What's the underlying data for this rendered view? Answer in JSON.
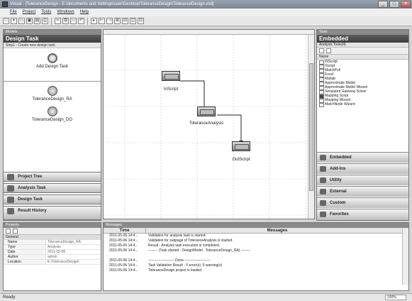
{
  "window": {
    "title": "Visual - [ToleranceDesign - E:\\documents and Settings\\user\\Desktop\\ToleranceDesign\\ToleranceDesign.vsd]",
    "controls": [
      "_",
      "□",
      "×"
    ]
  },
  "menu": {
    "items": [
      "File",
      "Project",
      "Tools",
      "Windows",
      "Help"
    ]
  },
  "toolbar": {
    "glyphs": [
      "□",
      "▾",
      "▭",
      "▣",
      "▤",
      "⎙",
      "✂",
      "⧉",
      "▭",
      "↶",
      "▸",
      "⊢",
      "⊣",
      "⊞",
      "⊟",
      "◫",
      "⊡"
    ]
  },
  "left_panel": {
    "section": "Models",
    "title": "Design Task",
    "hint": "Step1 : Create new design task.",
    "add_task_label": "Add Design Task",
    "tasks": [
      "ToleranceDesign_RA",
      "ToleranceDesign_DO"
    ],
    "nav": [
      "Project Tree",
      "Analysis Task",
      "Design Task",
      "Result History"
    ]
  },
  "properties": {
    "section": "Property",
    "category": "General",
    "rows": [
      {
        "key": "Name",
        "value": "ToleranceDesign_RA"
      },
      {
        "key": "Type",
        "value": "Analysis"
      },
      {
        "key": "Date",
        "value": "2011-05-06"
      },
      {
        "key": "Author",
        "value": "admin"
      },
      {
        "key": "Location",
        "value": "E:\\ToleranceDesign\\"
      }
    ]
  },
  "canvas": {
    "nodes": [
      "InScript",
      "ToleranceAnalysis",
      "OutScript"
    ]
  },
  "right_panel": {
    "section": "Tools",
    "title": "Embedded",
    "subtitle": "Analysis Tools(4)",
    "column": "Name",
    "items": [
      "INScript",
      "IScript",
      "MatchPoll",
      "Excel",
      "Matlab",
      "Approximate Model",
      "Approximate Model Wizard",
      "Simulated Gateway Solver",
      "Mapping Script",
      "Mapping Wizard",
      "MatchNode Wizard"
    ],
    "dark_items": [
      8
    ],
    "categories": [
      "Embedded",
      "Add-Ins",
      "Utility",
      "External",
      "Custom",
      "Favorites"
    ]
  },
  "messages": {
    "section": "Messages",
    "columns": {
      "time": "Time",
      "message": "Messages"
    },
    "rows": [
      {
        "time": "2011-05-06 14:4...",
        "message": "Validation for analysis task is started."
      },
      {
        "time": "2011-05-06 14:4...",
        "message": "Validation for subpage of ToleranceAnalysis is started."
      },
      {
        "time": "2011-05-06 14:4...",
        "message": "Result - Analysis task execution is completed."
      },
      {
        "time": "2011-05-06 14:4...",
        "message": "-------- (Task started : DesignModel : ToleranceDesign_RA) --------"
      },
      {
        "time": "",
        "message": ""
      },
      {
        "time": "2011-05-06 14:4...",
        "message": "---------------------- Done ----------------------"
      },
      {
        "time": "2011-05-06 14:4...",
        "message": "Task Validation Result - 0 error(s), 0 warning(s)"
      },
      {
        "time": "2011-05-06 14:4...",
        "message": "ToleranceDesign project is loaded."
      }
    ]
  },
  "status": {
    "text": "Ready",
    "zoom": "100%"
  }
}
